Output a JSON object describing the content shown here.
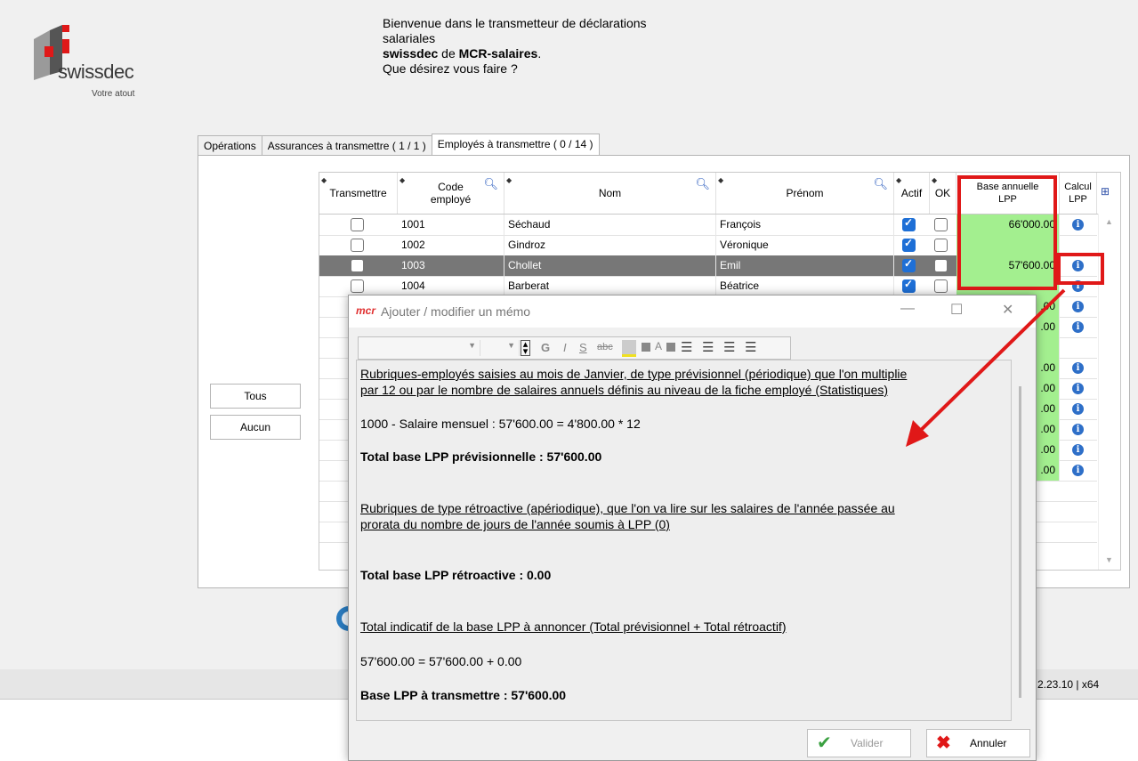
{
  "header": {
    "logo_text": "swissdec",
    "logo_sub": "Votre atout",
    "welcome_line1": "Bienvenue dans le transmetteur de déclarations",
    "welcome_line2": "salariales",
    "welcome_brand": "swissdec",
    "welcome_de": " de ",
    "welcome_product": "MCR-salaires",
    "welcome_dot": ".",
    "welcome_question": "Que désirez vous faire ?"
  },
  "tabs": [
    {
      "label": "Opérations"
    },
    {
      "label": "Assurances à transmettre ( 1 / 1 )"
    },
    {
      "label": "Employés à transmettre ( 0 / 14 )"
    }
  ],
  "buttons": {
    "tous": "Tous",
    "aucun": "Aucun"
  },
  "grid": {
    "columns": {
      "transmettre": "Transmettre",
      "code1": "Code",
      "code2": "employé",
      "nom": "Nom",
      "prenom": "Prénom",
      "actif": "Actif",
      "ok": "OK",
      "base1": "Base annuelle",
      "base2": "LPP",
      "calcul1": "Calcul",
      "calcul2": "LPP"
    },
    "rows": [
      {
        "code": "1001",
        "nom": "Séchaud",
        "prenom": "François",
        "actif": true,
        "base": "66'000.00"
      },
      {
        "code": "1002",
        "nom": "Gindroz",
        "prenom": "Véronique",
        "actif": true,
        "base": ""
      },
      {
        "code": "1003",
        "nom": "Chollet",
        "prenom": "Emil",
        "actif": true,
        "base": "57'600.00"
      },
      {
        "code": "1004",
        "nom": "Barberat",
        "prenom": "Béatrice",
        "actif": true,
        "base": ""
      }
    ],
    "partial_values": [
      ".00",
      ".00",
      ".00",
      ".00",
      ".00",
      ".00",
      ".00",
      ".00"
    ]
  },
  "version": "2.23.10 | x64",
  "dialog": {
    "logo": "mcr",
    "title": "Ajouter / modifier un mémo",
    "toolbar": {
      "bold": "G",
      "italic": "I",
      "strike": "S",
      "abc": "abc"
    },
    "content": {
      "p1a": "Rubriques-employés saisies au mois de Janvier, de type prévisionnel (périodique) que l'on multiplie",
      "p1b": "par 12 ou par le nombre de salaires annuels définis au niveau de la fiche employé (Statistiques)",
      "p2": "1000 - Salaire mensuel : 57'600.00 = 4'800.00 * 12",
      "p3": "Total base LPP prévisionnelle : 57'600.00",
      "p4a": "Rubriques de type rétroactive (apériodique), que l'on va lire sur les salaires de l'année passée au",
      "p4b": "prorata du nombre de jours de l'année soumis à LPP (0)",
      "p5": "Total base LPP rétroactive : 0.00",
      "p6": "Total indicatif de la base LPP à annoncer (Total prévisionnel + Total rétroactif)",
      "p7": "57'600.00 = 57'600.00 + 0.00",
      "p8": "Base LPP à transmettre : 57'600.00"
    },
    "valider": "Valider",
    "annuler": "Annuler"
  },
  "colors": {
    "accent_red": "#e01818",
    "green": "#a3ef8f",
    "info_blue": "#2e6fc8"
  }
}
